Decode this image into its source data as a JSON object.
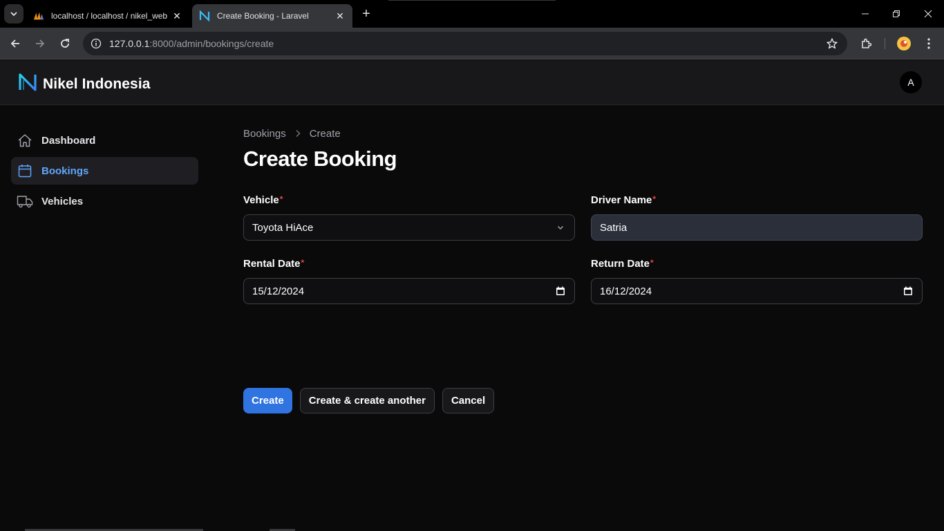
{
  "browser": {
    "tabs": [
      {
        "title": "localhost / localhost / nikel_web",
        "active": false
      },
      {
        "title": "Create Booking - Laravel",
        "active": true
      }
    ],
    "new_tab": "+",
    "url_host": "127.0.0.1",
    "url_rest": ":8000/admin/bookings/create"
  },
  "app": {
    "brand": "Nikel Indonesia",
    "avatar_initial": "A",
    "accent_color": "#60a5fa",
    "primary_button_color": "#2f74e0"
  },
  "sidebar": {
    "items": [
      {
        "label": "Dashboard",
        "icon": "home-icon",
        "active": false
      },
      {
        "label": "Bookings",
        "icon": "calendar-icon",
        "active": true
      },
      {
        "label": "Vehicles",
        "icon": "truck-icon",
        "active": false
      }
    ]
  },
  "main": {
    "breadcrumb": [
      "Bookings",
      "Create"
    ],
    "title": "Create Booking",
    "form": {
      "vehicle": {
        "label": "Vehicle",
        "required": "*",
        "value": "Toyota HiAce"
      },
      "driver_name": {
        "label": "Driver Name",
        "required": "*",
        "value": "Satria"
      },
      "rental_date": {
        "label": "Rental Date",
        "required": "*",
        "value": "15/12/2024"
      },
      "return_date": {
        "label": "Return Date",
        "required": "*",
        "value": "16/12/2024"
      }
    },
    "actions": {
      "create": "Create",
      "create_another": "Create & create another",
      "cancel": "Cancel"
    }
  }
}
